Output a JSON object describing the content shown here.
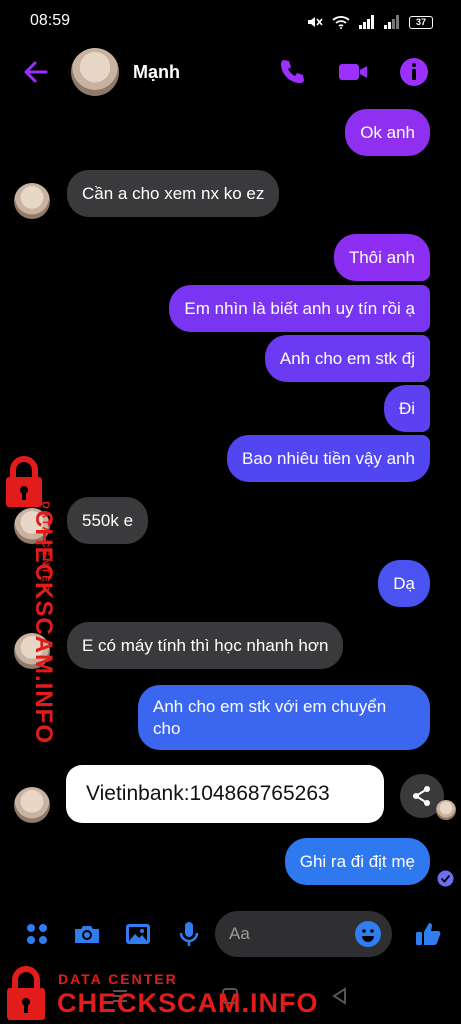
{
  "status_bar": {
    "time": "08:59",
    "battery": "37"
  },
  "header": {
    "contact_name": "Mạnh"
  },
  "messages": [
    {
      "direction": "out",
      "text": "Ok anh"
    },
    {
      "direction": "in",
      "text": "Cần a cho xem nx ko ez"
    },
    {
      "direction": "out",
      "text": "Thôi anh"
    },
    {
      "direction": "out",
      "text": "Em nhìn là biết anh uy tín rồi ạ"
    },
    {
      "direction": "out",
      "text": "Anh cho em stk đj"
    },
    {
      "direction": "out",
      "text": "Đi"
    },
    {
      "direction": "out",
      "text": "Bao nhiêu tiền vậy anh"
    },
    {
      "direction": "in",
      "text": "550k e"
    },
    {
      "direction": "out",
      "text": "Dạ"
    },
    {
      "direction": "in",
      "text": "E có máy tính thì học nhanh hơn"
    },
    {
      "direction": "out",
      "text": "Anh cho em stk với em chuyển cho"
    },
    {
      "direction": "in",
      "text": "Vietinbank:104868765263"
    },
    {
      "direction": "out",
      "text": "Ghi ra đi địt mẹ"
    }
  ],
  "composer": {
    "placeholder": "Aa"
  },
  "watermark": {
    "sub_label": "DATA CENTER",
    "main_label": "CHECKSCAM.INFO"
  },
  "colors": {
    "accent": "#9b30ff",
    "outgoing_top": "#8f2ff0",
    "outgoing_bottom": "#2e78f0",
    "incoming": "#3a3a3c",
    "watermark": "#e21b1b"
  }
}
